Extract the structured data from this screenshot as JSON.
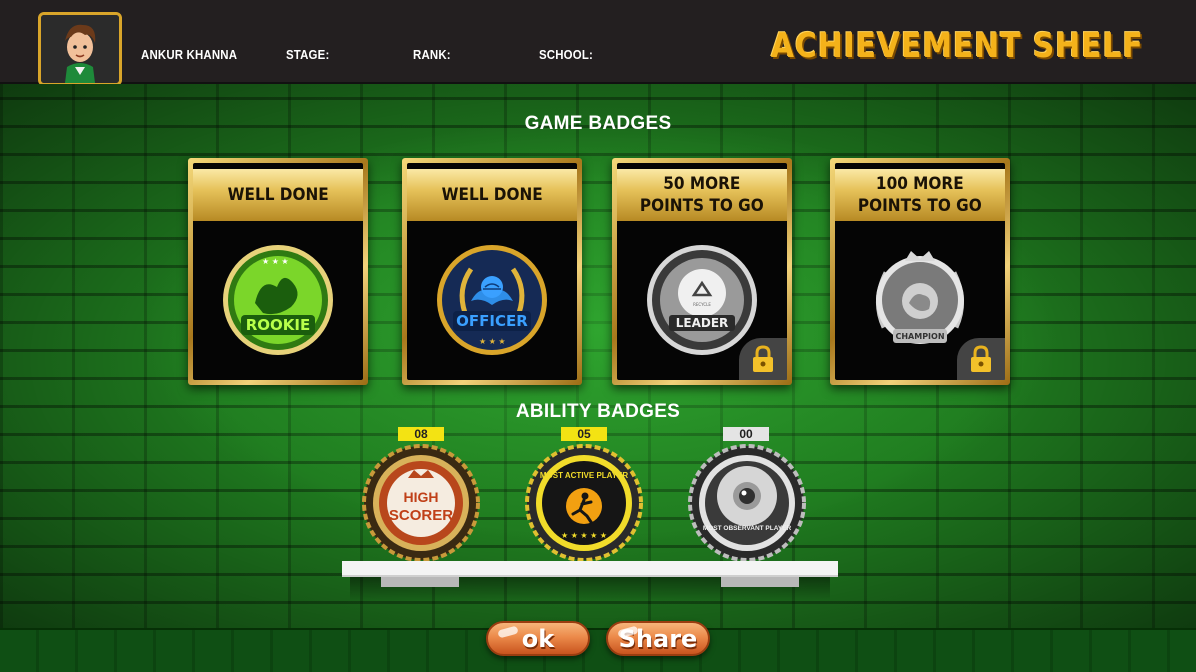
{
  "header": {
    "title": "ACHIEVEMENT SHELF",
    "player_name": "ANKUR KHANNA",
    "stage_label": "STAGE:",
    "rank_label": "RANK:",
    "school_label": "SCHOOL:"
  },
  "game_badges": {
    "title": "GAME BADGES",
    "cards": [
      {
        "header": "WELL DONE",
        "badge_text": "ROOKIE",
        "locked": false
      },
      {
        "header": "WELL DONE",
        "badge_text": "OFFICER",
        "locked": false
      },
      {
        "header": "50 MORE\nPOINTS TO GO",
        "badge_text": "LEADER",
        "locked": true
      },
      {
        "header": "100 MORE\nPOINTS TO GO",
        "badge_text": "CHAMPION",
        "locked": true
      }
    ]
  },
  "ability_badges": {
    "title": "ABILITY BADGES",
    "items": [
      {
        "count": "08",
        "line1": "HIGH",
        "line2": "SCORER"
      },
      {
        "count": "05",
        "label": "MOST ACTIVE PLAYER"
      },
      {
        "count": "00",
        "label": "MOST OBSERVANT PLAYER"
      }
    ]
  },
  "buttons": {
    "ok": "ok",
    "share": "Share"
  },
  "colors": {
    "title": "#f4b21a",
    "button": "#ec8a4a",
    "gold": "#d9a52a",
    "count_yellow": "#f3e313"
  }
}
